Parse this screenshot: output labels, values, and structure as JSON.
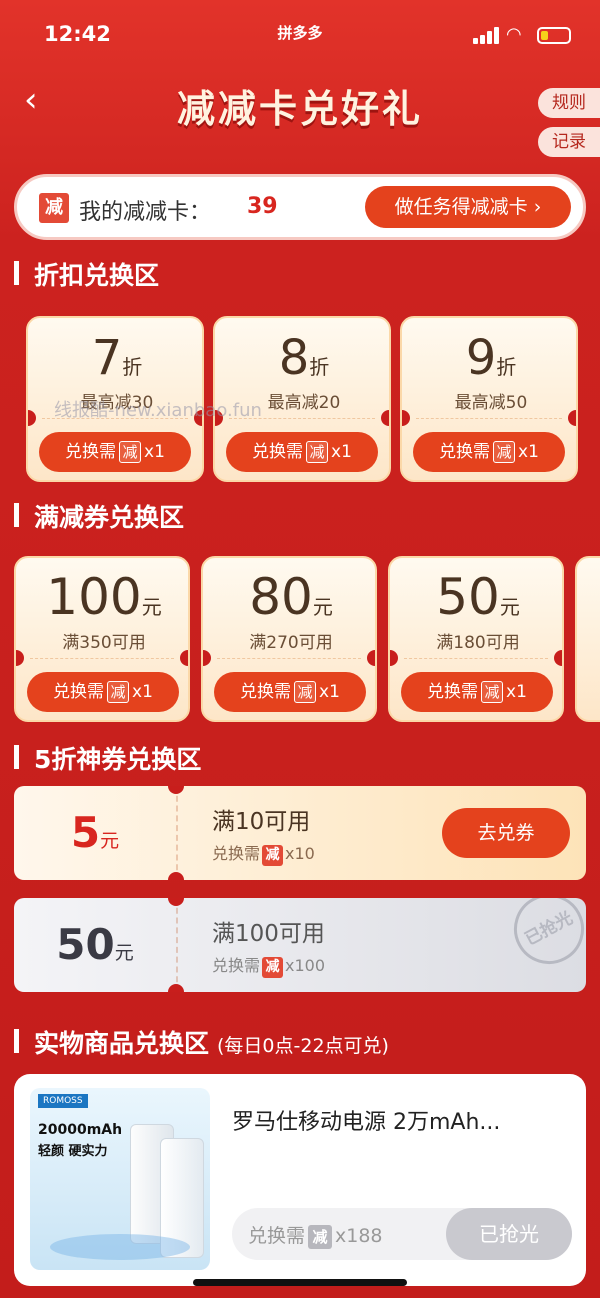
{
  "status": {
    "time": "12:42",
    "app": "拼多多"
  },
  "header": {
    "title": "减减卡兑好礼",
    "rules": "规则",
    "records": "记录"
  },
  "cardbar": {
    "badge": "减",
    "label": "我的减减卡：",
    "count": "39",
    "task_button": "做任务得减减卡 ›"
  },
  "sections": {
    "discount": "折扣兑换区",
    "manjian": "满减券兑换区",
    "half": "5折神券兑换区",
    "physical": "实物商品兑换区",
    "physical_note": "(每日0点-22点可兑)"
  },
  "exchange": {
    "prefix": "兑换需",
    "badge": "减",
    "x1": "x1"
  },
  "discount_cards": [
    {
      "value": "7",
      "unit": "折",
      "limit": "最高减30"
    },
    {
      "value": "8",
      "unit": "折",
      "limit": "最高减20"
    },
    {
      "value": "9",
      "unit": "折",
      "limit": "最高减50"
    }
  ],
  "manjian_cards": [
    {
      "value": "100",
      "unit": "元",
      "cond": "满350可用"
    },
    {
      "value": "80",
      "unit": "元",
      "cond": "满270可用"
    },
    {
      "value": "50",
      "unit": "元",
      "cond": "满180可用"
    }
  ],
  "half_cards": [
    {
      "value": "5",
      "unit": "元",
      "cond": "满10可用",
      "req_prefix": "兑换需",
      "badge": "减",
      "qty": "x10",
      "button": "去兑券"
    },
    {
      "value": "50",
      "unit": "元",
      "cond": "满100可用",
      "req_prefix": "兑换需",
      "badge": "减",
      "qty": "x100",
      "stamp": "已抢光"
    }
  ],
  "product": {
    "title": "罗马仕移动电源 2万mAh...",
    "req_prefix": "兑换需",
    "badge": "减",
    "qty": "x188",
    "button": "已抢光",
    "image_text": {
      "brand": "ROMOSS",
      "capacity": "20000mAh",
      "slogan": "轻颜 硬实力"
    }
  },
  "watermark": "线报酷-new.xianbao.fun",
  "colors": {
    "primary_red": "#c81e1c",
    "button_orange": "#e4421d",
    "card_cream": "#fde6c8",
    "badge_red": "#e34a36"
  }
}
